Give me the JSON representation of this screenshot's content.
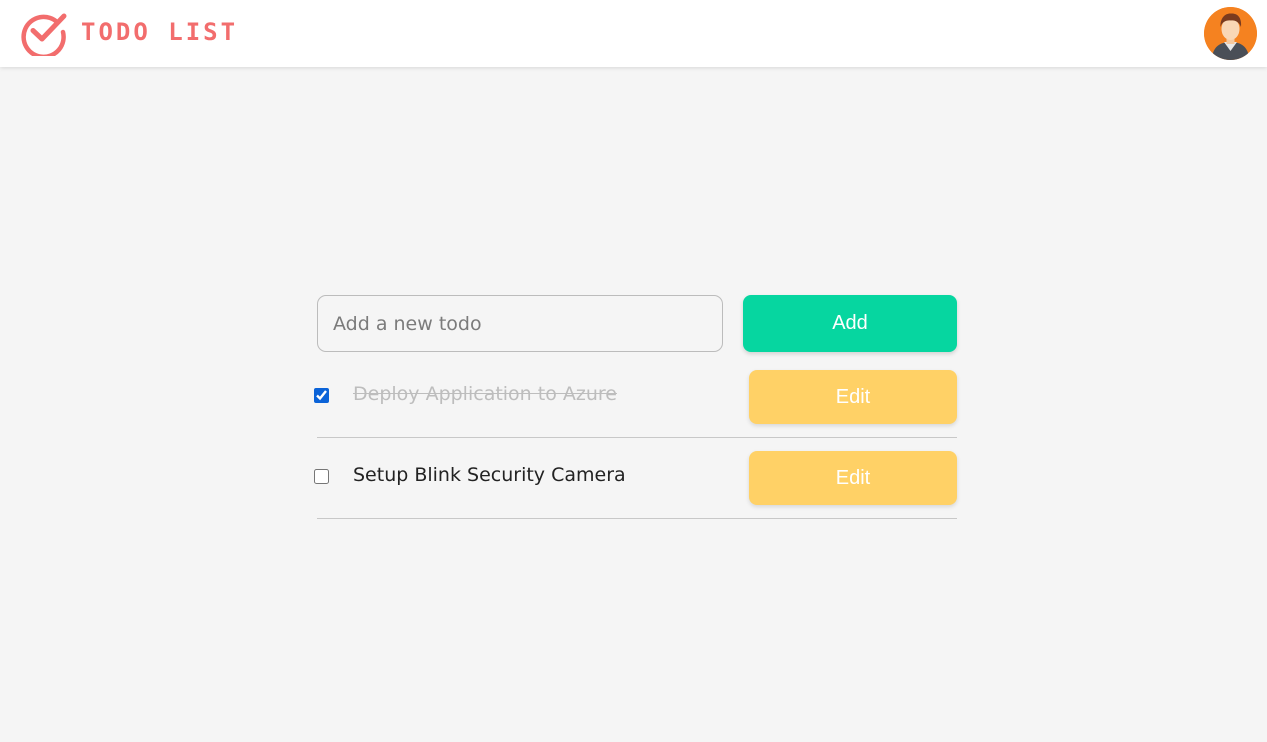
{
  "header": {
    "title": "TODO LIST",
    "logo_icon": "check-circle-icon",
    "avatar_icon": "user-avatar-icon",
    "brand_color": "#f26d6d"
  },
  "form": {
    "placeholder": "Add a new todo",
    "value": "",
    "add_label": "Add",
    "add_color": "#06d6a0"
  },
  "todos": [
    {
      "text": "Deploy Application to Azure",
      "completed": true,
      "edit_label": "Edit"
    },
    {
      "text": "Setup Blink Security Camera",
      "completed": false,
      "edit_label": "Edit"
    }
  ],
  "colors": {
    "edit_button": "#ffd166",
    "background": "#f5f5f5"
  }
}
